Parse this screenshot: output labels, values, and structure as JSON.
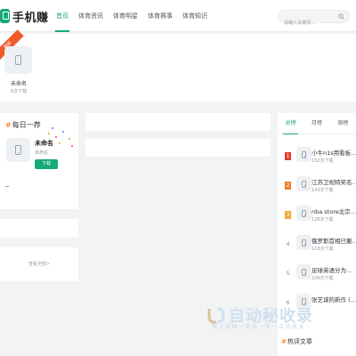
{
  "header": {
    "logo_text": "手机赚",
    "nav": [
      "首页",
      "体育资讯",
      "体育明星",
      "体育赛事",
      "体育知识"
    ],
    "active_nav": 0,
    "search_placeholder": "请输入关键词..."
  },
  "top_strip": {
    "ribbon": "最新",
    "app_name": "未命名",
    "app_count": "0次下载"
  },
  "daily": {
    "hash": "#",
    "title": "每日一荐",
    "app_name": "未命名",
    "app_sub": "未命名",
    "download_label": "下载"
  },
  "view_all": "查看全部>",
  "ranking": {
    "tabs": [
      "总榜",
      "月榜",
      "周榜"
    ],
    "active_tab": 0,
    "items": [
      {
        "rank": "1",
        "name": "小牛n1s用看板...",
        "count": "152次下载",
        "color": "#e83b2e"
      },
      {
        "rank": "2",
        "name": "江苏卫视特奖名...",
        "count": "143次下载",
        "color": "#f07b2a"
      },
      {
        "rank": "3",
        "name": "nba store北京...",
        "count": "128次下载",
        "color": "#f2a531"
      },
      {
        "rank": "4",
        "name": "俄罗斯首相已撤...",
        "count": "118次下载",
        "color": ""
      },
      {
        "rank": "5",
        "name": "足球英语分为...",
        "count": "106次下载",
        "color": ""
      },
      {
        "rank": "6",
        "name": "张艺谋的新作 (...",
        "count": "",
        "color": ""
      }
    ]
  },
  "hot": {
    "hash": "#",
    "title": "热评文章"
  },
  "watermark": {
    "title": "自动秘收录",
    "subtitle": "做上线排一来访一次一自动收录一"
  },
  "colors": {
    "accent": "#16a97a",
    "ribbon": "#f05a28",
    "hash": "#ff6a00"
  }
}
